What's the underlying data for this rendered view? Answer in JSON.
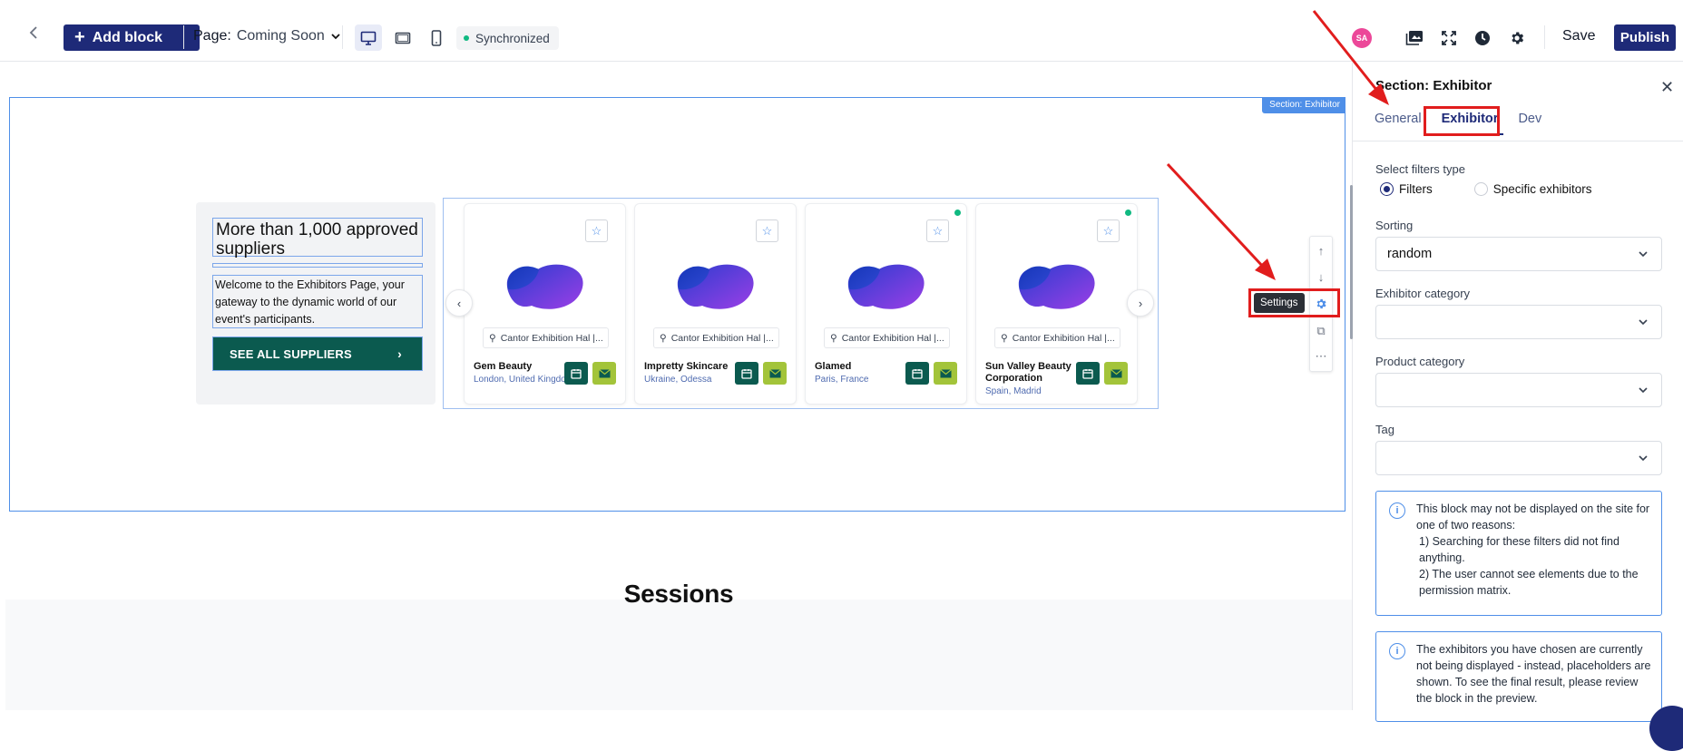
{
  "toolbar": {
    "add_block_label": "Add block",
    "page_label": "Page:",
    "page_value": "Coming Soon",
    "sync_status": "Synchronized",
    "avatar_initials": "SA",
    "save_label": "Save",
    "publish_label": "Publish"
  },
  "canvas": {
    "section_tag": "Section: Exhibitor",
    "headline": "More than 1,000 approved suppliers",
    "description": "Welcome to the Exhibitors Page, your gateway to the dynamic world of our event's participants.",
    "cta_label": "SEE ALL SUPPLIERS",
    "tooltip": "Settings",
    "next_section_title": "Sessions",
    "exhibitors": [
      {
        "name": "Gem Beauty",
        "city": "London, United Kingdom",
        "location": "Cantor Exhibition Hal |...",
        "online": false
      },
      {
        "name": "Impretty Skincare",
        "city": "Ukraine, Odessa",
        "location": "Cantor Exhibition Hal |...",
        "online": false
      },
      {
        "name": "Glamed",
        "city": "Paris, France",
        "location": "Cantor Exhibition Hal |...",
        "online": true
      },
      {
        "name": "Sun Valley Beauty Corporation",
        "city": "Spain, Madrid",
        "location": "Cantor Exhibition Hal |...",
        "online": true
      }
    ]
  },
  "panel": {
    "title": "Section: Exhibitor",
    "tabs": [
      {
        "label": "General",
        "active": false
      },
      {
        "label": "Exhibitor",
        "active": true
      },
      {
        "label": "Dev",
        "active": false
      }
    ],
    "filters_type_label": "Select filters type",
    "radio_filters": "Filters",
    "radio_specific": "Specific exhibitors",
    "sorting_label": "Sorting",
    "sorting_value": "random",
    "exhibitor_category_label": "Exhibitor category",
    "exhibitor_category_value": "",
    "product_category_label": "Product category",
    "product_category_value": "",
    "tag_label": "Tag",
    "tag_value": "",
    "info1": {
      "line1": "This block may not be displayed on the site for one of two reasons:",
      "line2": "1) Searching for these filters did not find anything.",
      "line3": "2) The user cannot see elements due to the permission matrix."
    },
    "info2": {
      "text": "The exhibitors you have chosen are currently not being displayed - instead, placeholders are shown. To see the final result, please review the block in the preview."
    }
  },
  "colors": {
    "brand": "#1e2a78",
    "cta_green": "#0b5a4f",
    "accent_lime": "#a3c43a",
    "selection_blue": "#4f8fe8",
    "annotation_red": "#e11d1d"
  },
  "icons": {
    "back": "chevron-left-icon",
    "desktop": "desktop-icon",
    "tablet": "tablet-icon",
    "mobile": "mobile-icon",
    "media": "media-library-icon",
    "fullscreen": "fullscreen-icon",
    "history": "history-icon",
    "settings": "gear-icon"
  }
}
